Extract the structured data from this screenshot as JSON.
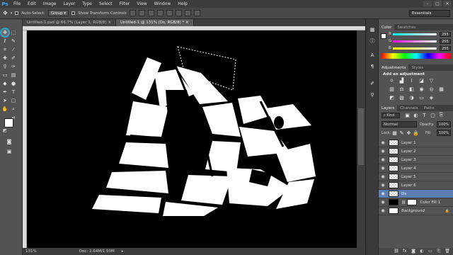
{
  "app": {
    "logo": "Ps"
  },
  "menu": [
    "File",
    "Edit",
    "Image",
    "Layer",
    "Type",
    "Select",
    "Filter",
    "View",
    "Window",
    "Help"
  ],
  "window_buttons": [
    "–",
    "□",
    "✕"
  ],
  "options_bar": {
    "auto_select_label": "Auto-Select:",
    "auto_select_value": "Group",
    "show_transform_label": "Show Transform Controls",
    "workspace": "Essentials"
  },
  "tabs": [
    {
      "label": "Untitled-1.psd @ 66.7% (Layer 1, RGB/8)"
    },
    {
      "label": "Untitled-1 @ 131% (Ds, RGB/8) *"
    }
  ],
  "canvas": {
    "text": "Ds",
    "text_color": "#ffffff",
    "background": "#000000"
  },
  "status": {
    "zoom": "131%",
    "doc": "Doc: 2.64M/1.50M"
  },
  "color_panel": {
    "tabs": [
      "Color",
      "Swatches"
    ],
    "channels": [
      {
        "label": "R",
        "value": "255"
      },
      {
        "label": "G",
        "value": "255"
      },
      {
        "label": "B",
        "value": "255"
      }
    ]
  },
  "adjustments_panel": {
    "tabs": [
      "Adjustments",
      "Styles"
    ],
    "title": "Add an adjustment"
  },
  "layers_panel": {
    "tabs": [
      "Layers",
      "Channels",
      "Paths"
    ],
    "filter": "Kind",
    "blend_mode": "Normal",
    "opacity_label": "Opacity:",
    "opacity_value": "100%",
    "lock_label": "Lock:",
    "fill_label": "Fill:",
    "fill_value": "100%",
    "layers": [
      {
        "name": "Layer 1",
        "thumb": "checker"
      },
      {
        "name": "Layer 2",
        "thumb": "checker"
      },
      {
        "name": "Layer 3",
        "thumb": "checker"
      },
      {
        "name": "Layer 4",
        "thumb": "checker"
      },
      {
        "name": "Layer 5",
        "thumb": "checker"
      },
      {
        "name": "Layer 6",
        "thumb": "checker"
      },
      {
        "name": "Ds",
        "thumb": "checker",
        "active": true
      },
      {
        "name": "Color Fill 1",
        "thumb": "black"
      },
      {
        "name": "Background",
        "thumb": "white"
      }
    ]
  }
}
